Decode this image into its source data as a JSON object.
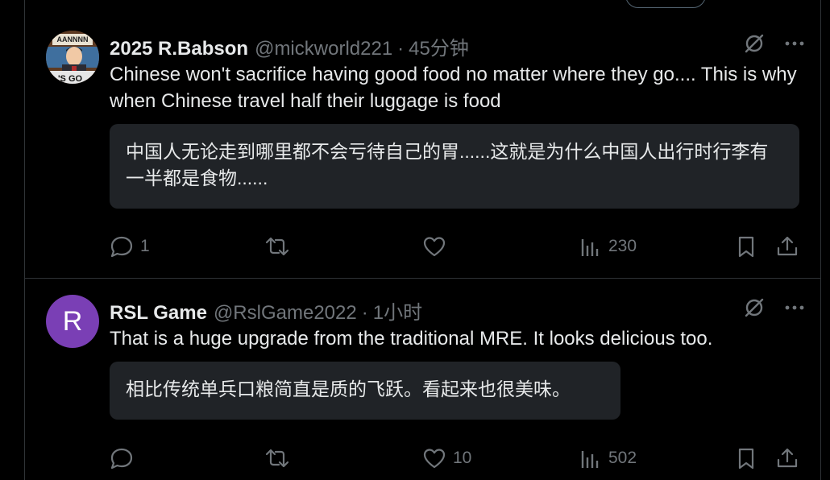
{
  "posts": [
    {
      "display_name": "2025 R.Babson",
      "handle": "@mickworld221",
      "separator": "·",
      "time": "45分钟",
      "text": "Chinese won't sacrifice having good food no matter where they go.... This is why when Chinese travel half their luggage is food",
      "translation": "中国人无论走到哪里都不会亏待自己的胃......这就是为什么中国人出行时行李有一半都是食物......",
      "avatar_text_top": "AANNNN",
      "avatar_text_bottom": "'S GO",
      "replies": "1",
      "reposts": "",
      "likes": "",
      "views": "230"
    },
    {
      "display_name": "RSL Game",
      "handle": "@RslGame2022",
      "separator": "·",
      "time": "1小时",
      "avatar_letter": "R",
      "text": "That is a huge upgrade from the traditional MRE. It looks delicious too.",
      "translation": "相比传统单兵口粮简直是质的飞跃。看起来也很美味。",
      "replies": "",
      "reposts": "",
      "likes": "10",
      "views": "502"
    }
  ],
  "icons": [
    "reply-icon",
    "repost-icon",
    "like-icon",
    "views-icon",
    "bookmark-icon",
    "share-icon",
    "grok-icon",
    "more-icon"
  ],
  "colors": {
    "background": "#000000",
    "text": "#e7e9ea",
    "muted": "#71767b",
    "translation_bg": "#202327",
    "avatar_purple": "#7a3fb5"
  }
}
